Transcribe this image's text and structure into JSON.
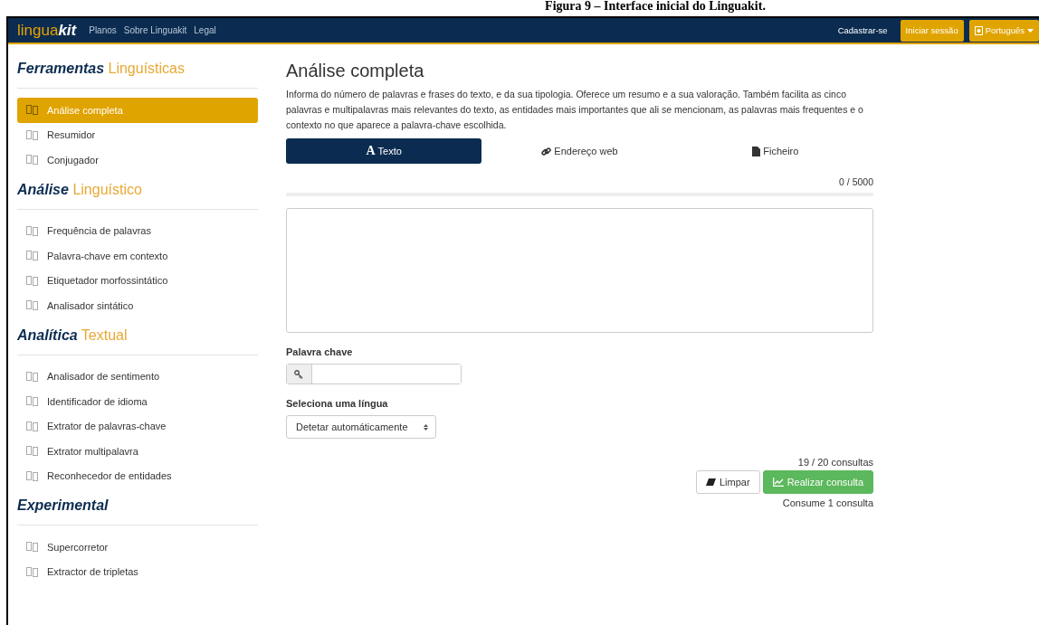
{
  "caption": "Figura 9 – Interface inicial do Linguakit.",
  "navbar": {
    "logo_main": "lingua",
    "logo_accent": "kit",
    "links": [
      "Planos",
      "Sobre Linguakit",
      "Legal"
    ],
    "signup": "Cadastrar-se",
    "login": "Iniciar sessão",
    "language": "Português"
  },
  "sidebar": [
    {
      "title": "Ferramentas",
      "accent": "Linguísticas",
      "items": [
        {
          "label": "Análise completa",
          "selected": true
        },
        {
          "label": "Resumidor",
          "selected": false
        },
        {
          "label": "Conjugador",
          "selected": false
        }
      ]
    },
    {
      "title": "Análise",
      "accent": "Linguístico",
      "items": [
        {
          "label": "Frequência de palavras",
          "selected": false
        },
        {
          "label": "Palavra-chave em contexto",
          "selected": false
        },
        {
          "label": "Etiquetador morfossintático",
          "selected": false
        },
        {
          "label": "Analisador sintático",
          "selected": false
        }
      ]
    },
    {
      "title": "Analítica",
      "accent": "Textual",
      "items": [
        {
          "label": "Analisador de sentimento",
          "selected": false
        },
        {
          "label": "Identificador de idioma",
          "selected": false
        },
        {
          "label": "Extrator de palavras-chave",
          "selected": false
        },
        {
          "label": "Extrator multipalavra",
          "selected": false
        },
        {
          "label": "Reconhecedor de entidades",
          "selected": false
        }
      ]
    },
    {
      "title": "Experimental",
      "items": [
        {
          "label": "Supercorretor",
          "selected": false
        },
        {
          "label": "Extractor de tripletas",
          "selected": false
        }
      ]
    }
  ],
  "main": {
    "title": "Análise completa",
    "description": "Informa do número de palavras e frases do texto, e da sua tipologia. Oferece um resumo e a sua valoração. Também facilita as cinco palavras e multipalavras mais relevantes do texto, as entidades mais importantes que ali se mencionam, as palavras mais frequentes e o contexto no que aparece a palavra-chave escolhida.",
    "tabs": [
      {
        "kind": "glyph",
        "glyph": "A",
        "label": "Texto",
        "selected": true
      },
      {
        "kind": "link",
        "label": "Endereço web",
        "selected": false
      },
      {
        "kind": "file",
        "label": "Ficheiro",
        "selected": false
      }
    ],
    "counter": "0 / 5000",
    "progress": {
      "level": 0
    },
    "keyword_label": "Palavra chave",
    "language_label": "Seleciona uma língua",
    "language_value": "Detetar automáticamente",
    "quota": "19 / 20 consultas",
    "clear_button": "Limpar",
    "submit_button": "Realizar consulta",
    "cost": "Consume 1 consulta"
  }
}
